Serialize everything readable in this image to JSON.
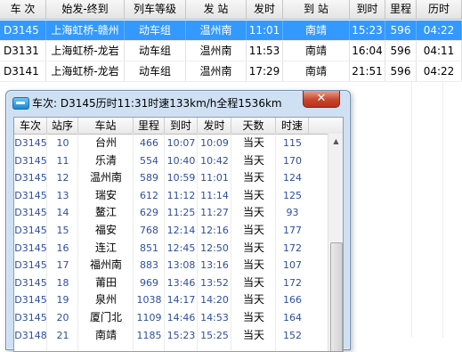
{
  "background_table": {
    "headers": [
      "车 次",
      "始发-终到",
      "列车等级",
      "发  站",
      "发时",
      "到  站",
      "到时",
      "里程",
      "历时"
    ],
    "rows": [
      [
        "D3145",
        "上海虹桥-赣州",
        "动车组",
        "温州南",
        "11:01",
        "南靖",
        "15:23",
        "596",
        "04:22"
      ],
      [
        "D3131",
        "上海虹桥-龙岩",
        "动车组",
        "温州南",
        "11:53",
        "南靖",
        "16:04",
        "596",
        "04:11"
      ],
      [
        "D3141",
        "上海虹桥-龙岩",
        "动车组",
        "温州南",
        "17:29",
        "南靖",
        "21:51",
        "596",
        "04:22"
      ]
    ],
    "selected_row": 0
  },
  "dialog": {
    "title": "车次: D3145历时11:31时速133km/h全程1536km",
    "close_label": "✕",
    "headers": [
      "车次",
      "站序",
      "车站",
      "里程",
      "到时",
      "发时",
      "天数",
      "时速"
    ],
    "rows": [
      [
        "D3145",
        "10",
        "台州",
        "466",
        "10:07",
        "10:09",
        "当天",
        "115"
      ],
      [
        "D3145",
        "11",
        "乐清",
        "554",
        "10:40",
        "10:42",
        "当天",
        "170"
      ],
      [
        "D3145",
        "12",
        "温州南",
        "589",
        "10:59",
        "11:01",
        "当天",
        "124"
      ],
      [
        "D3145",
        "13",
        "瑞安",
        "612",
        "11:12",
        "11:14",
        "当天",
        "125"
      ],
      [
        "D3145",
        "14",
        "鳌江",
        "629",
        "11:25",
        "11:27",
        "当天",
        "93"
      ],
      [
        "D3145",
        "15",
        "福安",
        "768",
        "12:14",
        "12:16",
        "当天",
        "177"
      ],
      [
        "D3145",
        "16",
        "连江",
        "851",
        "12:45",
        "12:50",
        "当天",
        "172"
      ],
      [
        "D3145",
        "17",
        "福州南",
        "883",
        "13:08",
        "13:16",
        "当天",
        "107"
      ],
      [
        "D3145",
        "18",
        "莆田",
        "969",
        "13:46",
        "13:52",
        "当天",
        "172"
      ],
      [
        "D3145",
        "19",
        "泉州",
        "1038",
        "14:17",
        "14:20",
        "当天",
        "166"
      ],
      [
        "D3145",
        "20",
        "厦门北",
        "1109",
        "14:46",
        "14:53",
        "当天",
        "164"
      ],
      [
        "D3148",
        "21",
        "南靖",
        "1185",
        "15:23",
        "15:25",
        "当天",
        "152"
      ]
    ]
  },
  "colors": {
    "selection": "#3399ff",
    "code_text": "#2f4ea0"
  },
  "icons": {
    "app": "train-app-icon",
    "close": "close-icon",
    "scroll_up": "scroll-up-arrow-icon"
  }
}
